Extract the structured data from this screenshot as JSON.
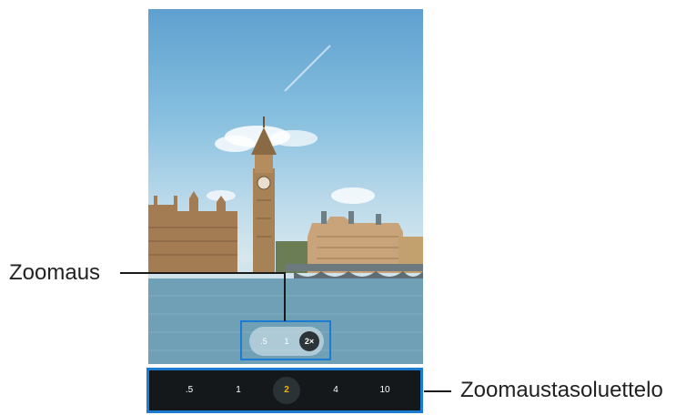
{
  "callouts": {
    "zoom": "Zoomaus",
    "zoom_level_list": "Zoomaustasoluettelo"
  },
  "viewfinder_zoom": {
    "options": [
      ".5",
      "1",
      "2×"
    ],
    "selected": "2×"
  },
  "zoom_level_list": {
    "items": [
      ".5",
      "1",
      "2",
      "4",
      "10"
    ],
    "selected": "2",
    "selected_color": "#f2b600"
  },
  "colors": {
    "highlight_frame": "#1c7bd3",
    "bar_background": "#15181a"
  }
}
